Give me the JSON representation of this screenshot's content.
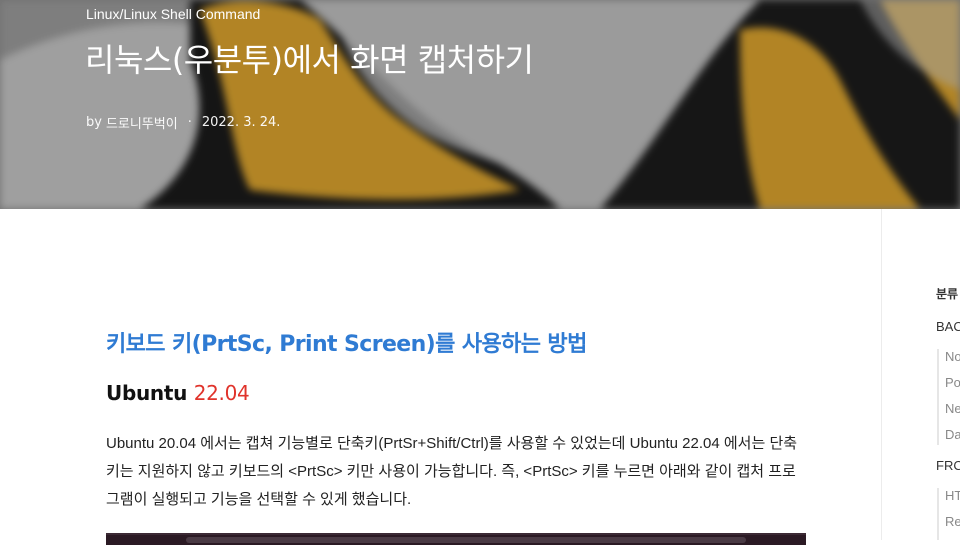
{
  "hero": {
    "category": "Linux/Linux Shell Command",
    "title": "리눅스(우분투)에서 화면 캡처하기",
    "by": "by",
    "author": "드로니뚜벅이",
    "separator": "·",
    "date": "2022. 3. 24."
  },
  "article": {
    "heading": "키보드 키(PrtSc, Print Screen)를 사용하는 방법",
    "subheading_prefix": "Ubuntu ",
    "subheading_version": "22.04",
    "paragraph": "Ubuntu 20.04 에서는 캡쳐 기능별로 단축키(PrtSr+Shift/Ctrl)를 사용할 수 있었는데 Ubuntu 22.04 에서는 단축키는 지원하지 않고 키보드의 <PrtSc> 키만 사용이 가능합니다. 즉, <PrtSc> 키를 누르면 아래와 같이 캡처 프로그램이 실행되고 기능을 선택할 수 있게 했습니다."
  },
  "sidebar": {
    "title": "분류",
    "groups": [
      {
        "label": "BAC",
        "items": [
          "No",
          "Po",
          "Ne",
          "Da"
        ]
      },
      {
        "label": "FRC",
        "items": [
          "HT",
          "Re"
        ]
      }
    ]
  },
  "colors": {
    "heading_blue": "#2f7bd3",
    "version_red": "#e0332b",
    "penguin_orange": "#d9a22e",
    "penguin_gray": "#b9b9b9"
  }
}
